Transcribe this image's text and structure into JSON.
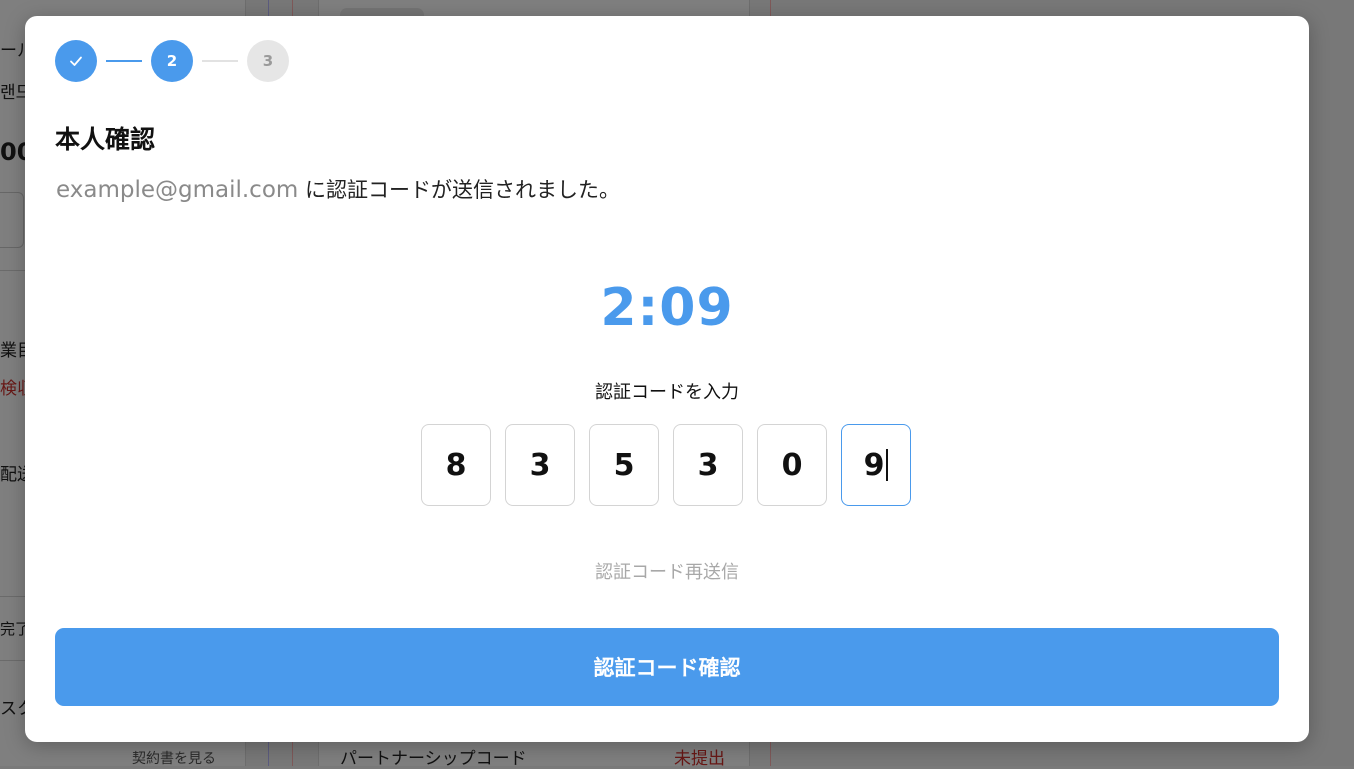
{
  "background": {
    "texts": [
      "ール",
      "랜드",
      "00",
      "業目",
      "検収",
      "配送",
      "完了",
      "スク"
    ],
    "contract_link": "契約書を見る",
    "partnership_label": "パートナーシップコード",
    "partnership_status": "未提出"
  },
  "stepper": {
    "steps": [
      {
        "label": "",
        "state": "done",
        "icon": "check-icon"
      },
      {
        "label": "2",
        "state": "active"
      },
      {
        "label": "3",
        "state": "todo"
      }
    ]
  },
  "modal": {
    "title": "本人確認",
    "email": "example@gmail.com",
    "message": " に認証コードが送信されました。",
    "timer": "2:09",
    "code_label": "認証コードを入力",
    "code_digits": [
      "8",
      "3",
      "5",
      "3",
      "0",
      "9"
    ],
    "resend_label": "認証コード再送信",
    "confirm_label": "認証コード確認"
  },
  "colors": {
    "accent": "#4a9aec",
    "muted": "#a8a8a8",
    "danger": "#d0312d"
  }
}
